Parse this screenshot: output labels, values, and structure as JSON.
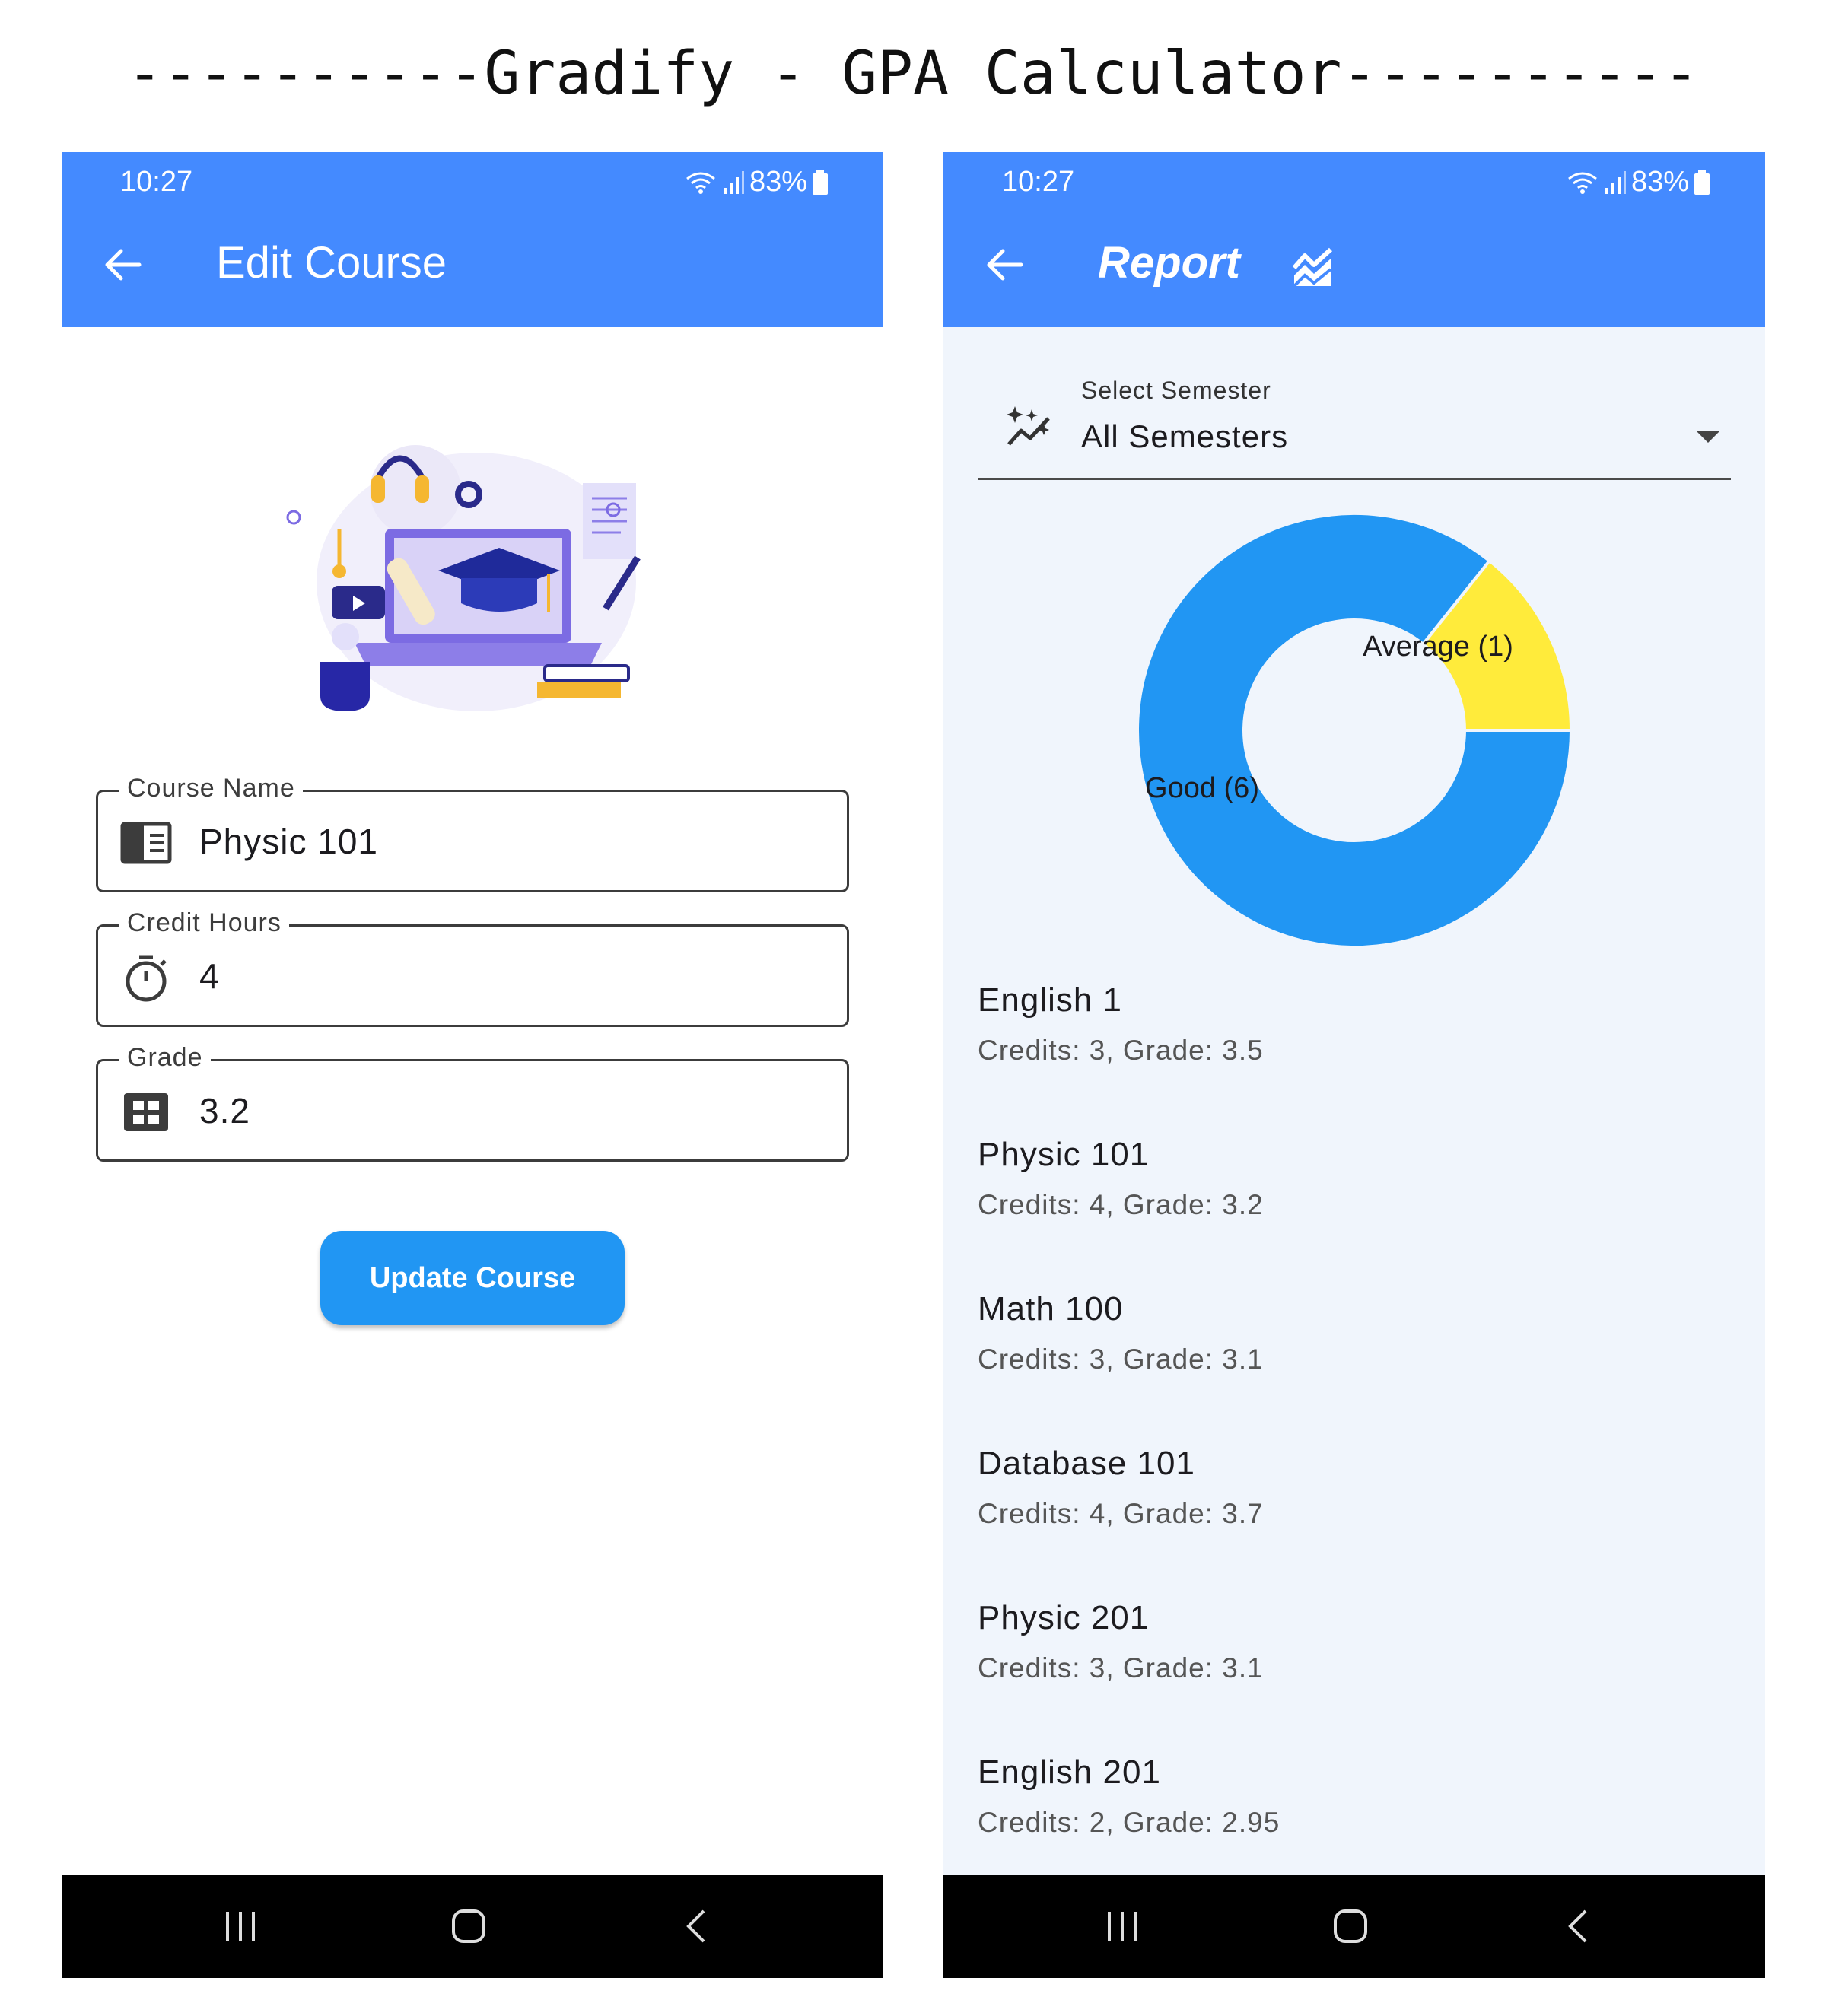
{
  "page_title": "----------Gradify - GPA Calculator----------",
  "status_bar": {
    "time": "10:27",
    "battery": "83%"
  },
  "edit_screen": {
    "title": "Edit Course",
    "fields": {
      "course_name": {
        "label": "Course Name",
        "value": "Physic 101"
      },
      "credit_hours": {
        "label": "Credit Hours",
        "value": "4"
      },
      "grade": {
        "label": "Grade",
        "value": "3.2"
      }
    },
    "update_button": "Update Course"
  },
  "report_screen": {
    "title": "Report",
    "semester_select": {
      "label": "Select Semester",
      "value": "All Semesters"
    },
    "chart_data": {
      "type": "pie",
      "style": "donut",
      "categories": [
        "Good",
        "Average"
      ],
      "values": [
        6,
        1
      ],
      "labels": [
        "Good (6)",
        "Average (1)"
      ],
      "colors": [
        "#2196f3",
        "#ffeb3b"
      ]
    },
    "courses": [
      {
        "name": "English 1",
        "details": "Credits: 3, Grade: 3.5"
      },
      {
        "name": "Physic 101",
        "details": "Credits: 4, Grade: 3.2"
      },
      {
        "name": "Math 100",
        "details": "Credits: 3, Grade: 3.1"
      },
      {
        "name": "Database 101",
        "details": "Credits: 4, Grade: 3.7"
      },
      {
        "name": "Physic 201",
        "details": "Credits: 3, Grade: 3.1"
      },
      {
        "name": "English 201",
        "details": "Credits: 2, Grade: 2.95"
      }
    ]
  },
  "icons": {
    "back": "arrow-left-icon",
    "report": "chart-icon",
    "semester": "sparkle-chart-icon",
    "course_name": "book-icon",
    "credit_hours": "timer-icon",
    "grade": "grid-icon"
  }
}
